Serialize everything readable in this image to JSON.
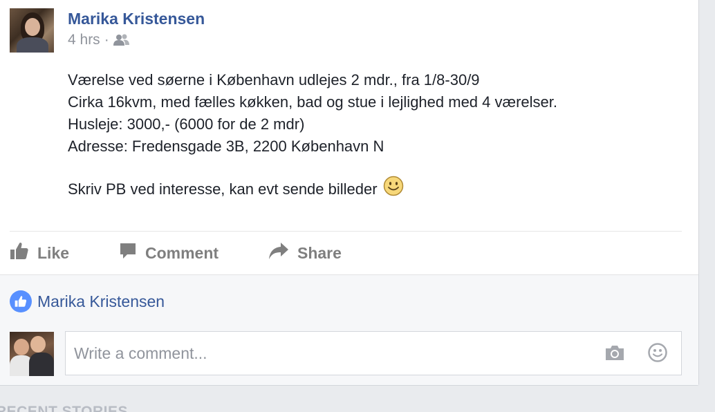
{
  "post": {
    "author": "Marika Kristensen",
    "time": "4 hrs",
    "separator": "·",
    "audience_icon": "friends-icon",
    "body_lines": [
      "Værelse ved søerne i København udlejes 2 mdr., fra 1/8-30/9",
      "Cirka 16kvm, med fælles køkken, bad og stue i lejlighed med 4 værelser.",
      "Husleje: 3000,- (6000 for de 2 mdr)",
      "Adresse: Fredensgade 3B, 2200 København N"
    ],
    "body_para2": "Skriv PB ved interesse, kan evt sende billeder",
    "emoji": "smiley-emoji"
  },
  "actions": {
    "like": "Like",
    "comment": "Comment",
    "share": "Share"
  },
  "reactions": {
    "liker": "Marika Kristensen",
    "icon": "like-badge-icon"
  },
  "comment_box": {
    "placeholder": "Write a comment...",
    "camera_icon": "camera-icon",
    "emoji_icon": "emoji-icon"
  },
  "section_below": {
    "label": "RECENT STORIES"
  },
  "colors": {
    "link": "#365899",
    "meta": "#90949c",
    "action": "#7f7f7f",
    "like_badge": "#5890ff",
    "page_bg": "#e9ebee"
  }
}
